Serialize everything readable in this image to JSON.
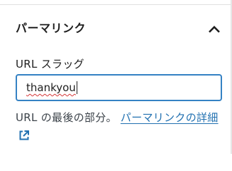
{
  "panel": {
    "title": "パーマリンク",
    "toggle_icon": "chevron-up-icon",
    "expanded": true
  },
  "slug_field": {
    "label": "URL スラッグ",
    "value": "thankyou",
    "spellcheck_flagged": true
  },
  "help": {
    "prefix": "URL の最後の部分。",
    "link_text": "パーマリンクの詳細",
    "link_icon": "external-link-icon"
  },
  "colors": {
    "link": "#2271b1",
    "focus_border": "#3582c4",
    "spellcheck_underline": "#d63638"
  }
}
